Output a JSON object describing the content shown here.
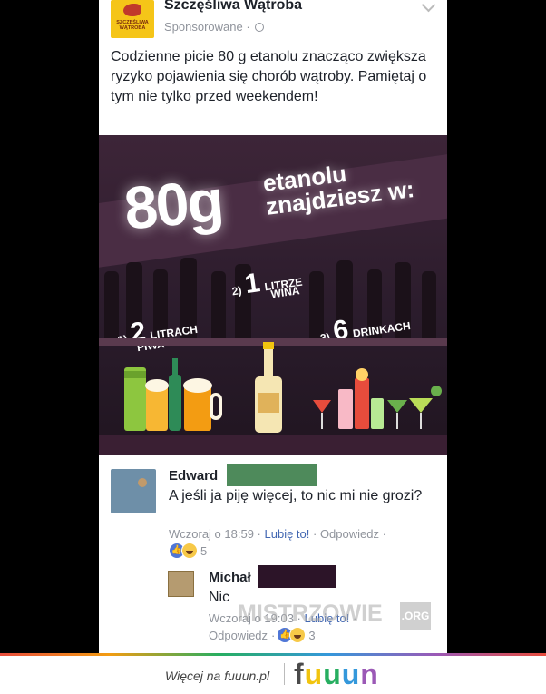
{
  "post": {
    "page_name": "Szczęśliwa Wątroba",
    "logo_text": "SZCZĘŚLIWA WĄTROBA",
    "sponsored": "Sponsorowane",
    "separator": "·",
    "text": "Codzienne picie 80 g etanolu znacząco zwiększa ryzyko pojawienia się chorób wątroby. Pamiętaj o tym nie tylko przed weekendem!"
  },
  "infographic": {
    "big_value": "80g",
    "headline_1": "etanolu",
    "headline_2": "znajdziesz w:",
    "item_1_num": "1)",
    "item_1_big": "2",
    "item_1_unit": "LITRACH",
    "item_1_word": "PIWA",
    "item_2_num": "2)",
    "item_2_big": "1",
    "item_2_unit": "LITRZE",
    "item_2_word": "WINA",
    "item_3_num": "3)",
    "item_3_big": "6",
    "item_3_unit": "DRINKACH"
  },
  "comments": [
    {
      "author": "Edward",
      "text": "A jeśli ja piję więcej, to nic mi nie grozi?",
      "time": "Wczoraj o 18:59",
      "like_label": "Lubię to!",
      "reply_label": "Odpowiedz",
      "reaction_count": "5"
    },
    {
      "author": "Michał",
      "text": "Nic",
      "time": "Wczoraj o 19:03",
      "like_label": "Lubię to!",
      "reply_label": "Odpowiedz",
      "reaction_count": "3"
    }
  ],
  "watermark": {
    "text": "MISTRZOWIE",
    "suffix": ".ORG"
  },
  "footer": {
    "more_link": "Więcej na fuuun.pl",
    "logo": "fuuun"
  },
  "colors": {
    "link": "#4267b2",
    "meta": "#90949c",
    "redaction_green": "#4e8a5b",
    "redaction_dark": "#2c1428"
  }
}
